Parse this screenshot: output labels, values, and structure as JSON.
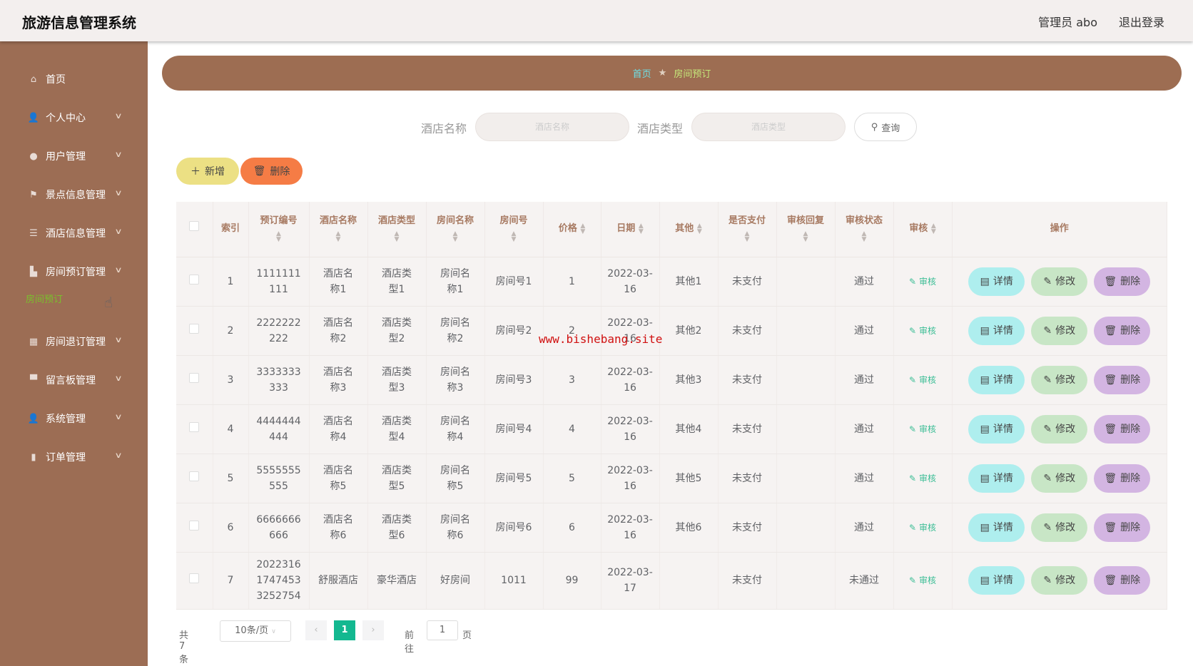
{
  "header": {
    "title": "旅游信息管理系统",
    "user": "管理员 abo",
    "logout": "退出登录"
  },
  "sidebar": {
    "items": [
      {
        "label": "首页",
        "icon": "home-icon",
        "chev": false
      },
      {
        "label": "个人中心",
        "icon": "user-icon",
        "chev": true
      },
      {
        "label": "用户管理",
        "icon": "pin-icon",
        "chev": true
      },
      {
        "label": "景点信息管理",
        "icon": "flag-icon",
        "chev": true
      },
      {
        "label": "酒店信息管理",
        "icon": "sliders-icon",
        "chev": true
      },
      {
        "label": "房间预订管理",
        "icon": "house-icon",
        "chev": true
      },
      {
        "label": "房间退订管理",
        "icon": "grid-icon",
        "chev": true
      },
      {
        "label": "留言板管理",
        "icon": "sign-icon",
        "chev": true
      },
      {
        "label": "系统管理",
        "icon": "user-icon",
        "chev": true
      },
      {
        "label": "订单管理",
        "icon": "chart-icon",
        "chev": true
      }
    ],
    "active_sub": "房间预订"
  },
  "breadcrumb": {
    "home": "首页",
    "current": "房间预订"
  },
  "search": {
    "label1": "酒店名称",
    "placeholder1": "酒店名称",
    "label2": "酒店类型",
    "placeholder2": "酒店类型",
    "query": "查询"
  },
  "toolbar": {
    "add": "新增",
    "delete": "删除"
  },
  "watermark": "www.bishebang.site",
  "table": {
    "columns": [
      "索引",
      "预订编号",
      "酒店名称",
      "酒店类型",
      "房间名称",
      "房间号",
      "价格",
      "日期",
      "其他",
      "是否支付",
      "审核回复",
      "审核状态",
      "审核",
      "操作"
    ],
    "rows": [
      [
        "1",
        "1111111111",
        "酒店名称1",
        "酒店类型1",
        "房间名称1",
        "房间号1",
        "1",
        "2022-03-16",
        "其他1",
        "未支付",
        "",
        "通过"
      ],
      [
        "2",
        "2222222222",
        "酒店名称2",
        "酒店类型2",
        "房间名称2",
        "房间号2",
        "2",
        "2022-03-16",
        "其他2",
        "未支付",
        "",
        "通过"
      ],
      [
        "3",
        "3333333333",
        "酒店名称3",
        "酒店类型3",
        "房间名称3",
        "房间号3",
        "3",
        "2022-03-16",
        "其他3",
        "未支付",
        "",
        "通过"
      ],
      [
        "4",
        "4444444444",
        "酒店名称4",
        "酒店类型4",
        "房间名称4",
        "房间号4",
        "4",
        "2022-03-16",
        "其他4",
        "未支付",
        "",
        "通过"
      ],
      [
        "5",
        "5555555555",
        "酒店名称5",
        "酒店类型5",
        "房间名称5",
        "房间号5",
        "5",
        "2022-03-16",
        "其他5",
        "未支付",
        "",
        "通过"
      ],
      [
        "6",
        "6666666666",
        "酒店名称6",
        "酒店类型6",
        "房间名称6",
        "房间号6",
        "6",
        "2022-03-16",
        "其他6",
        "未支付",
        "",
        "通过"
      ],
      [
        "7",
        "20223161747453325275​4",
        "舒服酒店",
        "豪华酒店",
        "好房间",
        "1011",
        "99",
        "2022-03-17",
        "",
        "未支付",
        "",
        "未通过"
      ]
    ],
    "audit_label": "审核",
    "detail": "详情",
    "edit": "修改",
    "delete": "删除"
  },
  "pager": {
    "total": "共 7 条",
    "size": "10条/页",
    "page": "1",
    "goto": "前往",
    "goto_value": "1",
    "page_unit": "页"
  },
  "colors": {
    "sidebar": "#9c6d54",
    "add": "#ece084",
    "delete": "#f57c45",
    "detail": "#aeeeee",
    "edit": "#c8e6c6",
    "del": "#d3b5e2",
    "page": "#13b890"
  }
}
